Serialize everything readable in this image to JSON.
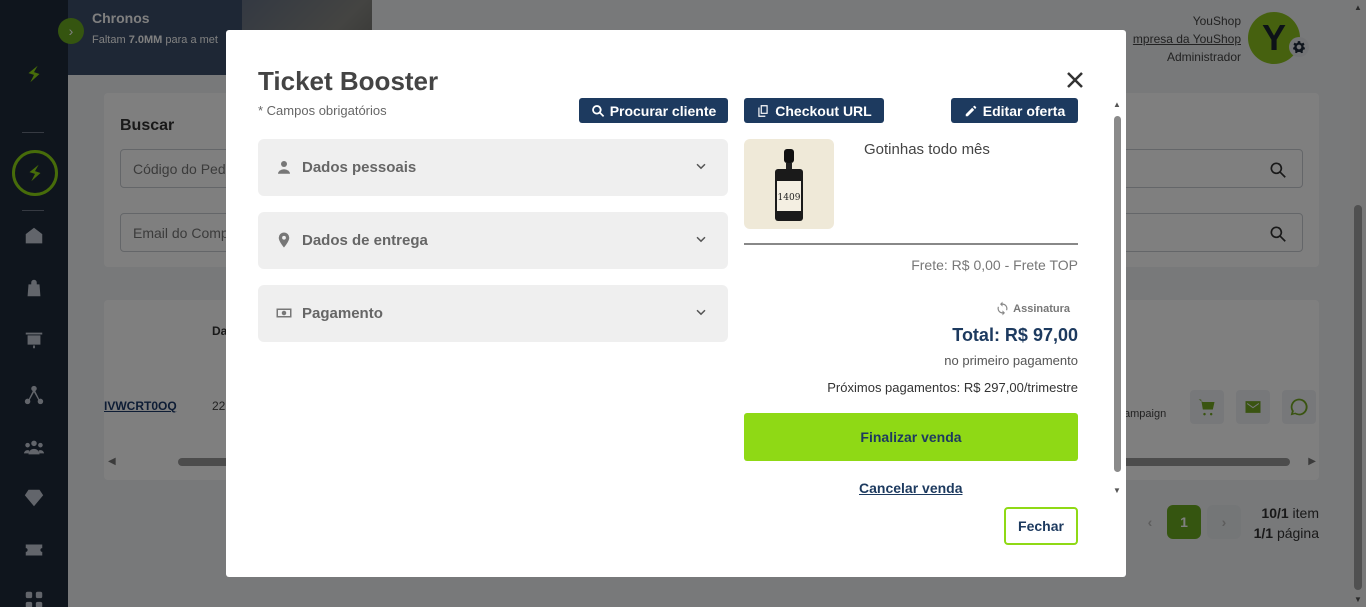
{
  "banner": {
    "title": "Chronos",
    "subtitle_prefix": "Faltam ",
    "subtitle_amount": "7.0MM",
    "subtitle_suffix": " para a met"
  },
  "user": {
    "name": "YouShop",
    "company": "mpresa da YouShop",
    "role": "Administrador",
    "avatar_letter": "Y"
  },
  "search": {
    "label": "Buscar",
    "order_placeholder": "Código do Ped",
    "email_placeholder": "Email do Comp"
  },
  "table": {
    "col_head": "Da",
    "order_id": "IVWCRT0OQ",
    "date": "22",
    "campaign": "ampaign"
  },
  "pagination": {
    "current_page": "1",
    "items_count": "10/1",
    "items_label": " item",
    "pages_count": "1/1",
    "pages_label": " página"
  },
  "modal": {
    "title": "Ticket Booster",
    "required_note": "* Campos obrigatórios",
    "buttons": {
      "search_client": "Procurar cliente",
      "checkout_url": "Checkout URL",
      "edit_offer": "Editar oferta"
    },
    "sections": [
      {
        "label": "Dados pessoais",
        "icon": "person-icon"
      },
      {
        "label": "Dados de entrega",
        "icon": "location-pin-icon"
      },
      {
        "label": "Pagamento",
        "icon": "money-icon"
      }
    ],
    "product": {
      "name": "Gotinhas todo mês",
      "bottle_label": "1409"
    },
    "shipping": "Frete: R$ 0,00 - Frete TOP",
    "subscription_label": "Assinatura",
    "total": "Total: R$ 97,00",
    "first_payment_note": "no primeiro pagamento",
    "next_payments": "Próximos pagamentos: R$ 297,00/trimestre",
    "finalize_label": "Finalizar venda",
    "cancel_label": "Cancelar venda",
    "close_label": "Fechar"
  },
  "colors": {
    "navy": "#1d3a5f",
    "accent_green": "#8fd915",
    "sidebar": "#1e2a3a"
  }
}
